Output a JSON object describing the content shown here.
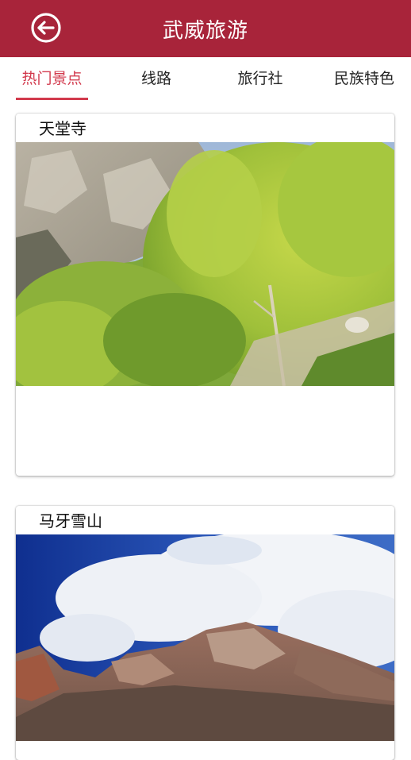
{
  "header": {
    "title": "武威旅游",
    "back_icon": "back-arrow-circle-icon"
  },
  "tabs": [
    {
      "label": "热门景点",
      "active": true
    },
    {
      "label": "线路",
      "active": false
    },
    {
      "label": "旅行社",
      "active": false
    },
    {
      "label": "民族特色",
      "active": false
    }
  ],
  "spots": [
    {
      "title": "天堂寺"
    },
    {
      "title": "马牙雪山"
    }
  ],
  "colors": {
    "primary": "#a8243a",
    "accent": "#d23a4d"
  }
}
